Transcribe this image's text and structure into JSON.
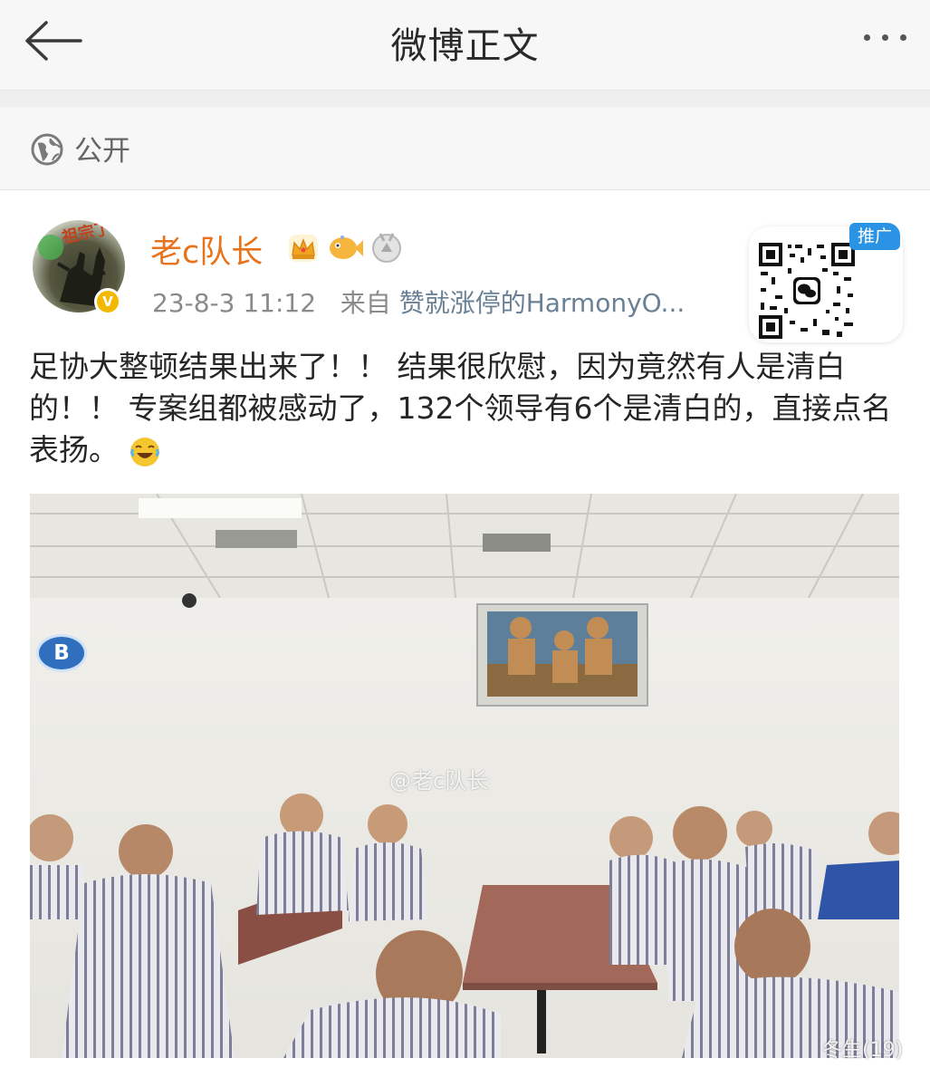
{
  "header": {
    "title": "微博正文",
    "back_icon": "arrow-left-icon",
    "more_icon": "more-dots-icon"
  },
  "visibility": {
    "icon": "globe-icon",
    "label": "公开"
  },
  "post": {
    "author": "老c队长",
    "avatar_tag": "祖宗了",
    "verified_badge": "V",
    "badges": [
      "crown-icon",
      "fish-icon",
      "medal-icon"
    ],
    "timestamp": "23-8-3 11:12",
    "source_prefix": "来自",
    "source": "赞就涨停的HarmonyO...",
    "promo_label": "推广",
    "content": "足协大整顿结果出来了！！ 结果很欣慰，因为竟然有人是清白的！！ 专案组都被感动了，132个领导有6个是清白的，直接点名表扬。",
    "emoji": "laughing-crying-emoji"
  },
  "photo": {
    "watermark": "@老c队长",
    "channel_logo": "B",
    "corner_label": "冬生(19)"
  },
  "colors": {
    "username": "#e8731d",
    "source": "#6a8095",
    "promo": "#2a93e3",
    "verified": "#f5b800"
  }
}
